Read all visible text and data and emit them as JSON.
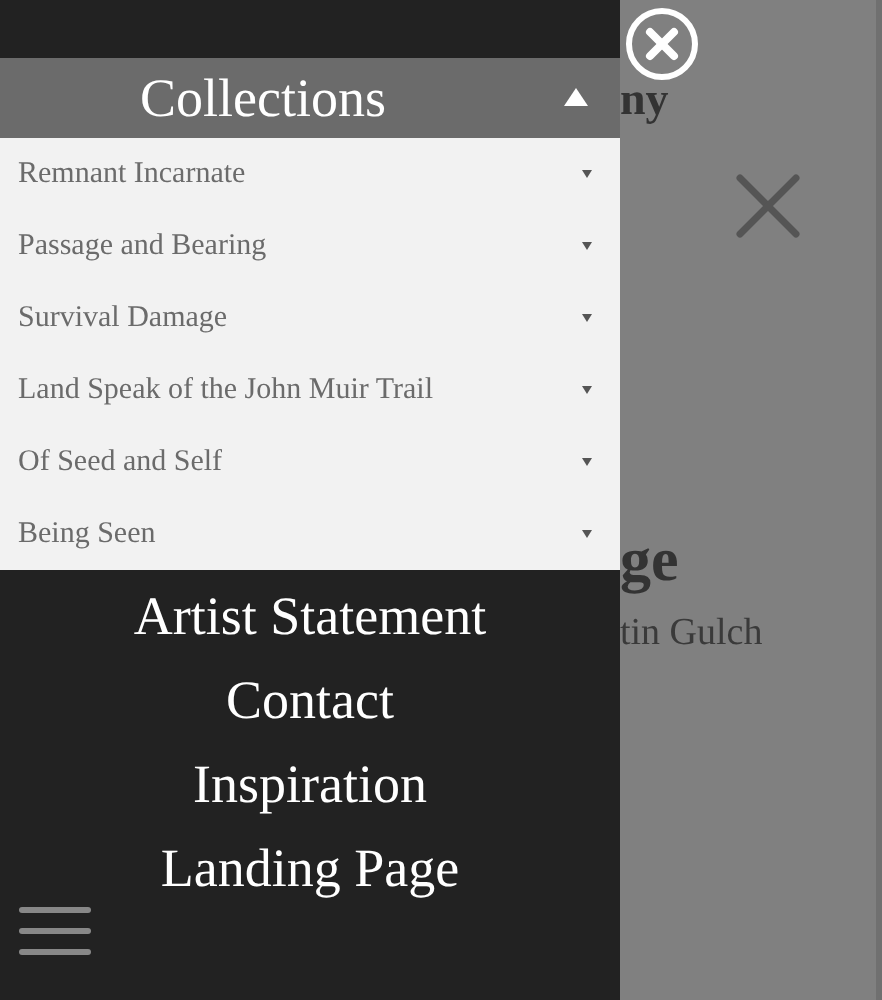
{
  "menu": {
    "header": {
      "label": "Collections",
      "expanded": true
    },
    "collections": [
      {
        "label": "Remnant Incarnate",
        "expanded": false
      },
      {
        "label": "Passage and Bearing",
        "expanded": false
      },
      {
        "label": "Survival Damage",
        "expanded": false
      },
      {
        "label": "Land Speak of the John Muir Trail",
        "expanded": false
      },
      {
        "label": "Of Seed and Self",
        "expanded": false
      },
      {
        "label": "Being Seen",
        "expanded": false
      }
    ],
    "links": [
      "Artist Statement",
      "Contact",
      "Inspiration",
      "Landing Page"
    ]
  },
  "page_behind": {
    "title_fragment": "ny",
    "heading_fragment": "ge",
    "subtitle_fragment": "tin Gulch"
  }
}
